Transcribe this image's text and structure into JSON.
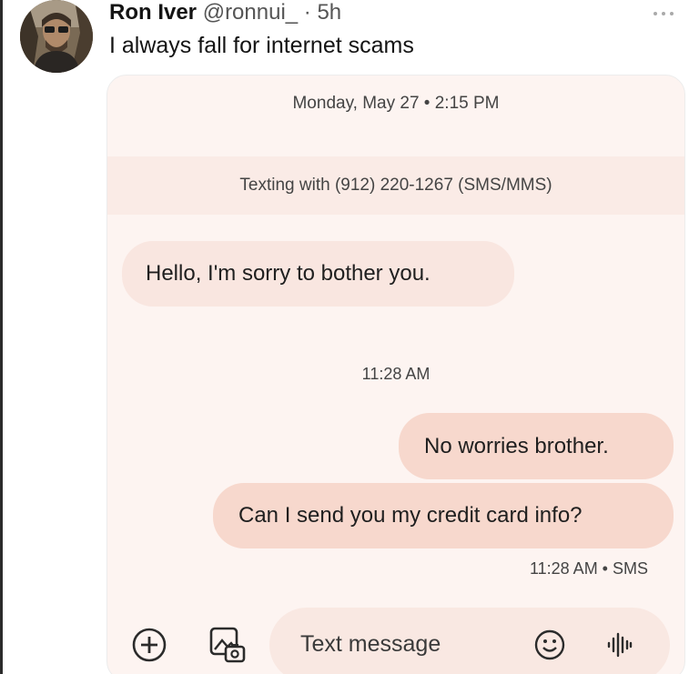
{
  "tweet": {
    "author_name": "Ron Iver",
    "handle_time": "@ronnui_ · 5h",
    "text": "I always fall for internet scams",
    "more_icon": "more-horizontal-icon"
  },
  "screenshot": {
    "date_header": "Monday, May 27 • 2:15 PM",
    "texting_with": "Texting with (912) 220-1267 (SMS/MMS)",
    "messages": [
      {
        "direction": "incoming",
        "text": "Hello, I'm sorry to bother you."
      },
      {
        "direction": "outgoing",
        "text": "No worries brother."
      },
      {
        "direction": "outgoing",
        "text": "Can I send you my credit card info?"
      }
    ],
    "timestamp_1": "11:28 AM",
    "timestamp_2": "11:28 AM • SMS",
    "compose": {
      "placeholder": "Text message",
      "add_icon": "plus-circle-icon",
      "media_icon": "gallery-icon",
      "emoji_icon": "smiley-icon",
      "voice_icon": "voice-wave-icon"
    }
  },
  "colors": {
    "card_background": "#fdf4f1",
    "incoming_bubble": "#f9e6e0",
    "outgoing_bubble": "#f7d8cd"
  }
}
